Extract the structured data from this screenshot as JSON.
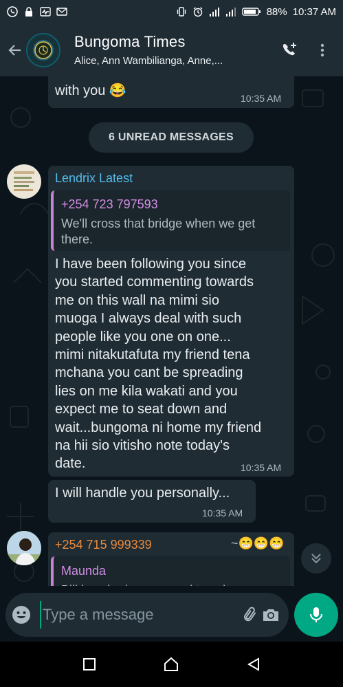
{
  "status_bar": {
    "battery": "88%",
    "time": "10:37 AM"
  },
  "header": {
    "title": "Bungoma Times",
    "participants": "Alice, Ann Wambilianga, Anne,..."
  },
  "messages": {
    "prev": {
      "text": "with you 😂",
      "time": "10:35 AM"
    },
    "unread_banner": "6 UNREAD MESSAGES",
    "msg1": {
      "sender": "Lendrix Latest",
      "sender_color": "#53bdeb",
      "quote_author": "+254 723 797593",
      "quote_text_line1": "We'll cross that bridge when we get",
      "quote_text_line2": "there.",
      "lines": [
        "I have been following you since",
        "you started commenting towards",
        "me on this wall na mimi sio",
        "muoga I always deal with such",
        "people like you one on one...",
        "mimi nitakutafuta my friend tena",
        "mchana you cant be spreading",
        "lies on me kila wakati  and you",
        "expect me to seat down and",
        "wait...bungoma ni home my friend",
        "na hii sio vitisho note today's",
        "date."
      ],
      "time": "10:35 AM"
    },
    "msg2": {
      "text": "I will handle you personally...",
      "time": "10:35 AM"
    },
    "msg3": {
      "sender": "+254 715 999339",
      "sender_color": "#e98a3c",
      "sender_name": "~😁😁😁",
      "quote_author": "Maunda",
      "quote_text": "Bill is nobody compared to sultan"
    }
  },
  "input": {
    "placeholder": "Type a message"
  },
  "colors": {
    "accent": "#00a884",
    "bubble": "#1f2c34",
    "background": "#0b141a"
  }
}
